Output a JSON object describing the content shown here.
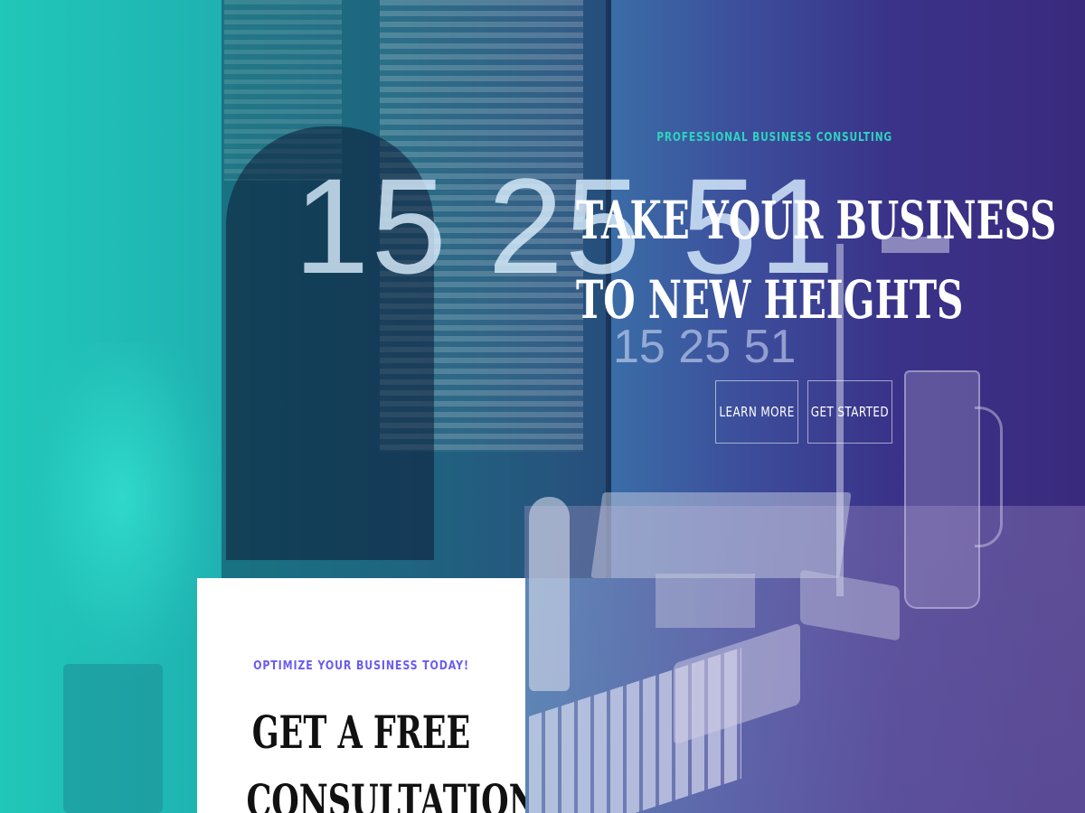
{
  "hero": {
    "background_clock_text_large": "15 25 51",
    "background_clock_text_small": "15 25 51",
    "eyebrow": "PROFESSIONAL BUSINESS CONSULTING",
    "headline_line1": "TAKE YOUR BUSINESS",
    "headline_line2": "TO NEW HEIGHTS",
    "buttons": {
      "learn_more": "LEARN MORE",
      "get_started": "GET STARTED"
    }
  },
  "card": {
    "eyebrow": "OPTIMIZE YOUR BUSINESS TODAY!",
    "title_line1": "GET A FREE",
    "title_line2": "CONSULTATION"
  },
  "colors": {
    "gradient_start": "#21c7b9",
    "gradient_end": "#3a2a7e",
    "eyebrow_teal": "#2dd4bf",
    "card_eyebrow_purple": "#6a5cf0",
    "headline_white": "#ffffff",
    "card_title_black": "#111111"
  }
}
